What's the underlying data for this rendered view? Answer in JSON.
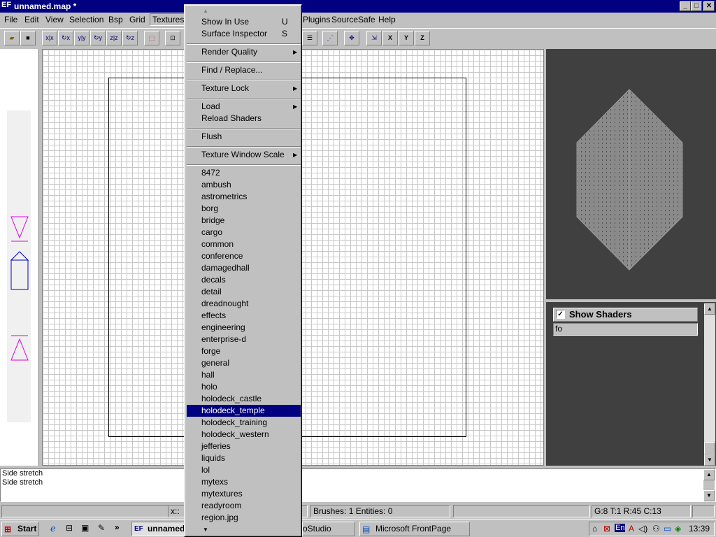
{
  "window": {
    "icon": "EF",
    "title": "unnamed.map *",
    "controls": [
      "minimize-icon",
      "maximize-icon",
      "close-icon"
    ]
  },
  "menubar": {
    "items": [
      "File",
      "Edit",
      "View",
      "Selection",
      "Bsp",
      "Grid",
      "Textures",
      "Plugins",
      "SourceSafe",
      "Help"
    ]
  },
  "textures_menu": {
    "top": [
      {
        "label": "Show In Use",
        "shortcut": "U"
      },
      {
        "label": "Surface Inspector",
        "shortcut": "S"
      }
    ],
    "render_quality": "Render Quality",
    "find_replace": "Find / Replace...",
    "texture_lock": "Texture Lock",
    "load": "Load",
    "reload_shaders": "Reload Shaders",
    "flush": "Flush",
    "texture_window_scale": "Texture Window Scale",
    "directories": [
      "8472",
      "ambush",
      "astrometrics",
      "borg",
      "bridge",
      "cargo",
      "common",
      "conference",
      "damagedhall",
      "decals",
      "detail",
      "dreadnought",
      "effects",
      "engineering",
      "enterprise-d",
      "forge",
      "general",
      "hall",
      "holo",
      "holodeck_castle",
      "holodeck_temple",
      "holodeck_training",
      "holodeck_western",
      "jefferies",
      "liquids",
      "lol",
      "mytexs",
      "mytextures",
      "readyroom",
      "region.jpg"
    ],
    "highlighted": "holodeck_temple"
  },
  "texture_panel": {
    "show_shaders_label": "Show Shaders",
    "show_shaders_checked": "✓",
    "filter_value": "fo"
  },
  "console": {
    "lines": [
      "Side stretch",
      "Side stretch"
    ]
  },
  "statusbar": {
    "coords": "x::",
    "counts": "Brushes: 1 Entities: 0",
    "grid_info": "G:8 T:1 R:45 C:13"
  },
  "taskbar": {
    "start": "Start",
    "tasks": [
      "unnamed.",
      "oStudio",
      "Microsoft FrontPage"
    ],
    "clock": "13:39",
    "lang": "En"
  }
}
